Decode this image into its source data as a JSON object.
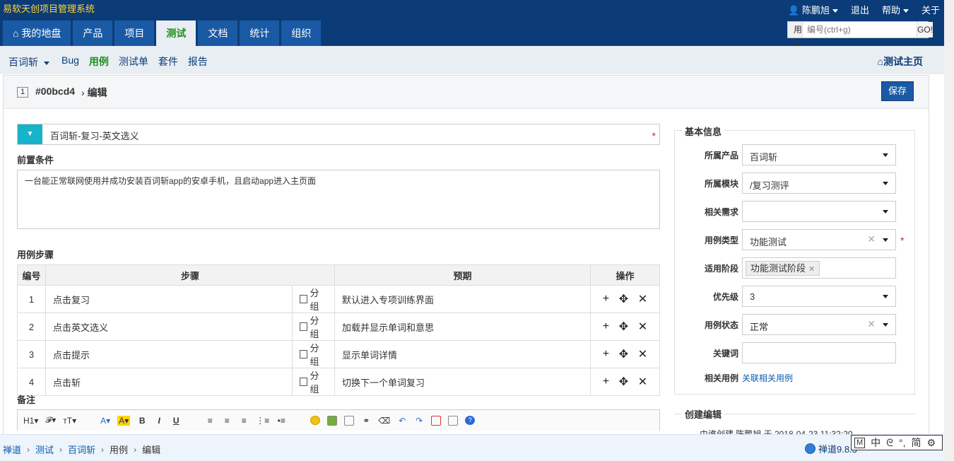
{
  "app": {
    "title": "易软天创项目管理系统"
  },
  "top_right": {
    "user": "陈鹏旭",
    "logout": "退出",
    "help": "帮助",
    "about": "关于"
  },
  "nav": {
    "tabs": [
      "我的地盘",
      "产品",
      "项目",
      "测试",
      "文档",
      "统计",
      "组织"
    ],
    "active": "测试"
  },
  "search": {
    "type": "用例",
    "placeholder": "编号(ctrl+g)",
    "go": "GO!"
  },
  "subnav": {
    "product": "百词斩",
    "items": [
      "Bug",
      "用例",
      "测试单",
      "套件",
      "报告"
    ],
    "active": "用例",
    "home": "测试主页"
  },
  "page": {
    "id_badge": "1",
    "case_id": "#00bcd4",
    "crumb_edit": "编辑",
    "save": "保存"
  },
  "form": {
    "title": "百词斩-复习-英文选义",
    "precondition_label": "前置条件",
    "precondition": "一台能正常联网使用并成功安装百词斩app的安卓手机，且启动app进入主页面",
    "steps_label": "用例步骤",
    "steps_headers": [
      "编号",
      "步骤",
      "预期",
      "操作"
    ],
    "group_label": "分组",
    "steps": [
      {
        "num": "1",
        "step": "点击复习",
        "expect": "默认进入专项训练界面"
      },
      {
        "num": "2",
        "step": "点击英文选义",
        "expect": "加载并显示单词和意思"
      },
      {
        "num": "3",
        "step": "点击提示",
        "expect": "显示单词详情"
      },
      {
        "num": "4",
        "step": "点击斩",
        "expect": "切换下一个单词复习"
      }
    ],
    "remark_label": "备注",
    "toolbar": [
      "H1",
      "𝓕",
      "тT",
      "A",
      "A",
      "B",
      "I",
      "U"
    ]
  },
  "info": {
    "section_title": "基本信息",
    "fields": [
      {
        "label": "所属产品",
        "value": "百词斩"
      },
      {
        "label": "所属模块",
        "value": "/复习测评"
      },
      {
        "label": "相关需求",
        "value": ""
      },
      {
        "label": "用例类型",
        "value": "功能测试"
      },
      {
        "label": "适用阶段",
        "value": "功能测试阶段"
      },
      {
        "label": "优先级",
        "value": "3"
      },
      {
        "label": "用例状态",
        "value": "正常"
      },
      {
        "label": "关键词",
        "value": ""
      },
      {
        "label": "相关用例",
        "value": "关联相关用例"
      }
    ],
    "section2_title": "创建编辑",
    "creator_line": "由谁创建 陈鹏旭 于 2018-04-23 11:32:20"
  },
  "footer": {
    "crumbs": [
      "禅道",
      "测试",
      "百词斩",
      "用例",
      "编辑"
    ],
    "version": "禅道9.8.3",
    "ime": [
      "M",
      "中",
      "ᘓ",
      "°,",
      "简",
      "⚙"
    ]
  }
}
